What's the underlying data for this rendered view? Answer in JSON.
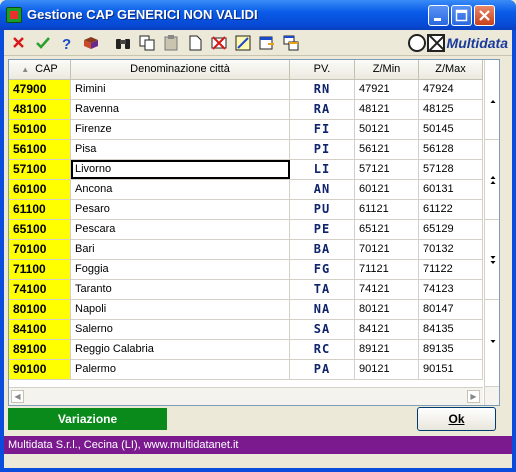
{
  "window": {
    "title": "Gestione CAP GENERICI NON VALIDI",
    "controls": {
      "minimize_icon": "minimize-icon",
      "maximize_icon": "maximize-icon",
      "close_icon": "close-icon"
    }
  },
  "toolbar": {
    "tools": [
      "delete-icon",
      "confirm-check-icon",
      "help-icon",
      "book-icon",
      "binoculars-icon",
      "copy-icon",
      "paste-icon",
      "new-document-icon",
      "delete-record-icon",
      "edit-icon",
      "export-icon",
      "window-icon"
    ],
    "brand": "Multidata"
  },
  "grid": {
    "columns": [
      "CAP",
      "Denominazione città",
      "PV.",
      "Z/Min",
      "Z/Max"
    ],
    "sort_indicator": "▲",
    "rows": [
      {
        "cap": "47900",
        "city": "Rimini",
        "pv": "RN",
        "zmin": "47921",
        "zmax": "47924"
      },
      {
        "cap": "48100",
        "city": "Ravenna",
        "pv": "RA",
        "zmin": "48121",
        "zmax": "48125"
      },
      {
        "cap": "50100",
        "city": "Firenze",
        "pv": "FI",
        "zmin": "50121",
        "zmax": "50145"
      },
      {
        "cap": "56100",
        "city": "Pisa",
        "pv": "PI",
        "zmin": "56121",
        "zmax": "56128"
      },
      {
        "cap": "57100",
        "city": "Livorno",
        "pv": "LI",
        "zmin": "57121",
        "zmax": "57128"
      },
      {
        "cap": "60100",
        "city": "Ancona",
        "pv": "AN",
        "zmin": "60121",
        "zmax": "60131"
      },
      {
        "cap": "61100",
        "city": "Pesaro",
        "pv": "PU",
        "zmin": "61121",
        "zmax": "61122"
      },
      {
        "cap": "65100",
        "city": "Pescara",
        "pv": "PE",
        "zmin": "65121",
        "zmax": "65129"
      },
      {
        "cap": "70100",
        "city": "Bari",
        "pv": "BA",
        "zmin": "70121",
        "zmax": "70132"
      },
      {
        "cap": "71100",
        "city": "Foggia",
        "pv": "FG",
        "zmin": "71121",
        "zmax": "71122"
      },
      {
        "cap": "74100",
        "city": "Taranto",
        "pv": "TA",
        "zmin": "74121",
        "zmax": "74123"
      },
      {
        "cap": "80100",
        "city": "Napoli",
        "pv": "NA",
        "zmin": "80121",
        "zmax": "80147"
      },
      {
        "cap": "84100",
        "city": "Salerno",
        "pv": "SA",
        "zmin": "84121",
        "zmax": "84135"
      },
      {
        "cap": "89100",
        "city": "Reggio Calabria",
        "pv": "RC",
        "zmin": "89121",
        "zmax": "89135"
      },
      {
        "cap": "90100",
        "city": "Palermo",
        "pv": "PA",
        "zmin": "90121",
        "zmax": "90151"
      }
    ],
    "selected_row": 4
  },
  "buttons": {
    "variazione": "Variazione",
    "ok": "Ok"
  },
  "status": "Multidata S.r.l., Cecina (LI), www.multidatanet.it",
  "colors": {
    "cap_column": "#ffff00",
    "variazione_button": "#0a8a1a",
    "status_bar": "#7a1a8e",
    "title_bar": "#0a5ce8"
  }
}
